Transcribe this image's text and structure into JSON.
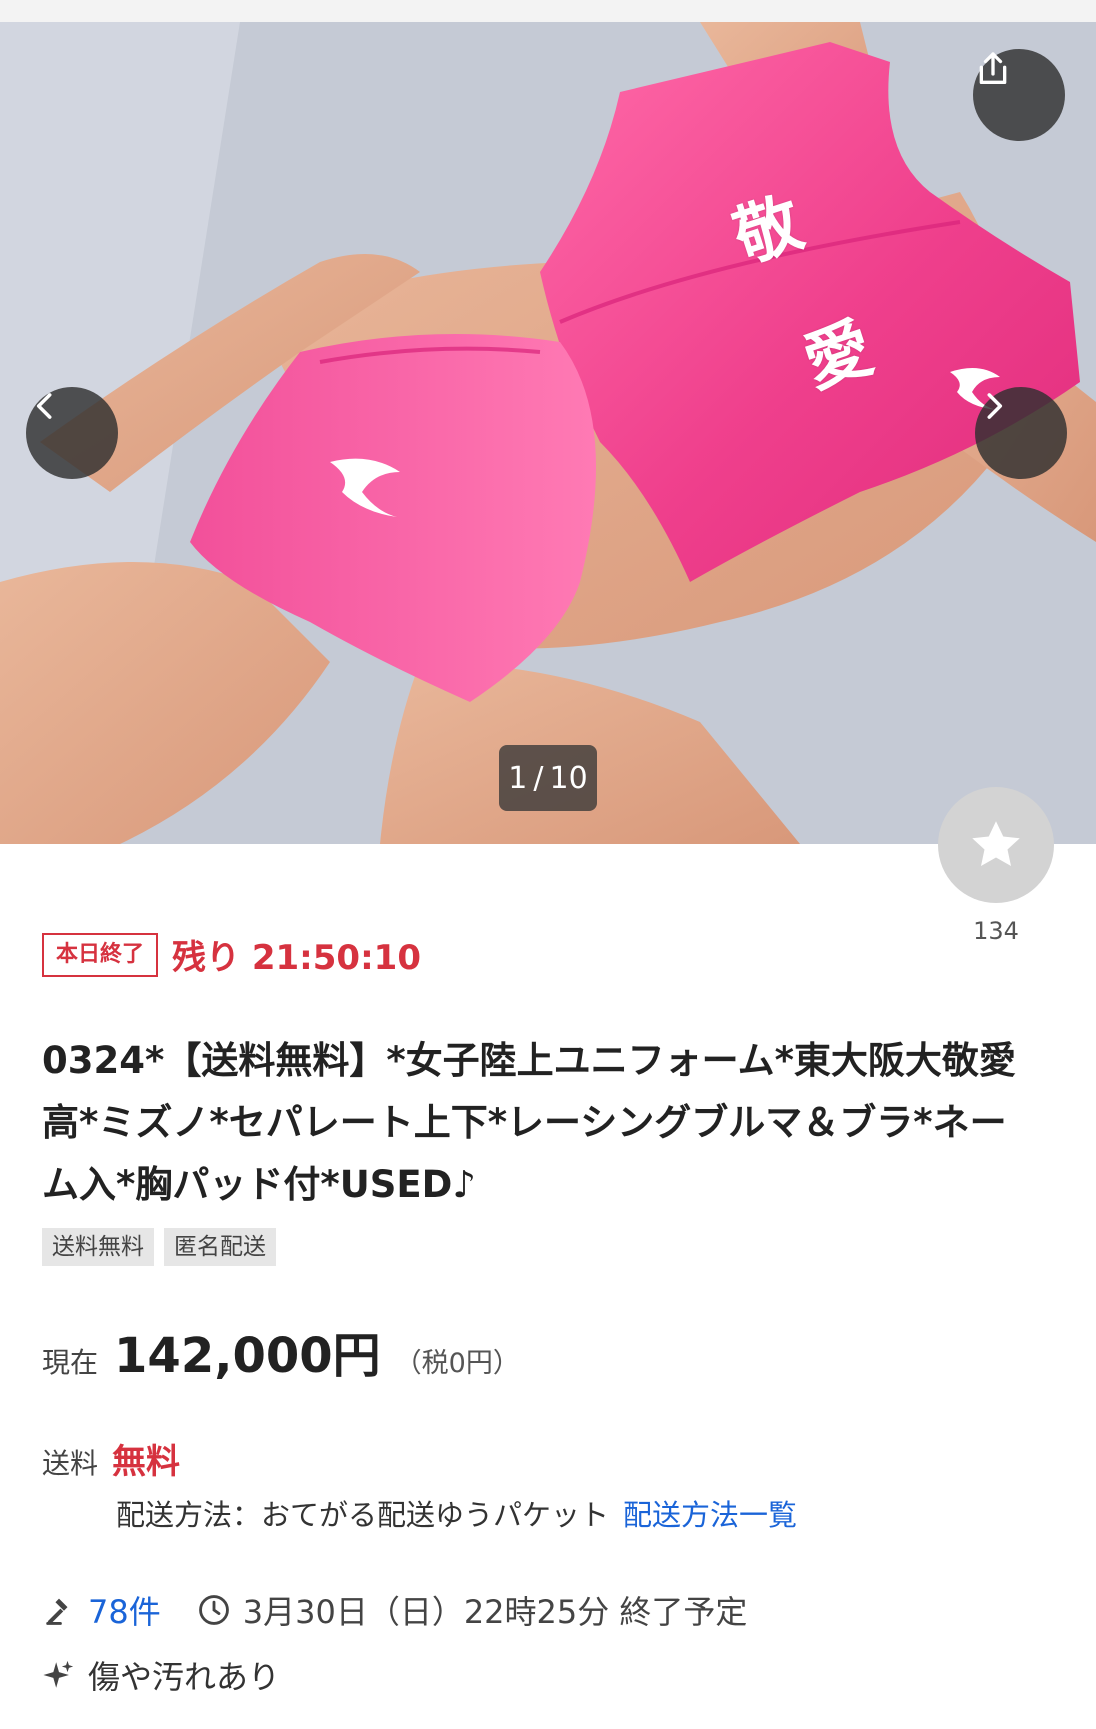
{
  "gallery": {
    "current": "1",
    "separator": "/",
    "total": "10",
    "print_char_1": "敬",
    "print_char_2": "愛"
  },
  "watch": {
    "count": "134"
  },
  "auction": {
    "ending_badge": "本日終了",
    "remaining": "残り 21:50:10",
    "title": "0324*【送料無料】*女子陸上ユニフォーム*東大阪大敬愛高*ミズノ*セパレート上下*レーシングブルマ＆ブラ*ネーム入*胸パッド付*USED♪",
    "tags": [
      "送料無料",
      "匿名配送"
    ],
    "price_label": "現在",
    "price": "142,000円",
    "tax": "（税0円）",
    "shipping_label": "送料",
    "shipping_value": "無料",
    "shipping_method": "配送方法：おてがる配送ゆうパケット",
    "shipping_method_link": "配送方法一覧",
    "bids": "78件",
    "end_time": "3月30日（日）22時25分 終了予定",
    "condition": "傷や汚れあり"
  },
  "icons": {
    "share": "share-icon",
    "prev": "chevron-left-icon",
    "next": "chevron-right-icon",
    "watch": "star-icon",
    "bid": "gavel-icon",
    "time": "clock-icon",
    "condition": "sparkle-icon"
  },
  "colors": {
    "accent_red": "#d6323f",
    "link_blue": "#1a64d8",
    "fabric_pink": "#f0468f"
  }
}
